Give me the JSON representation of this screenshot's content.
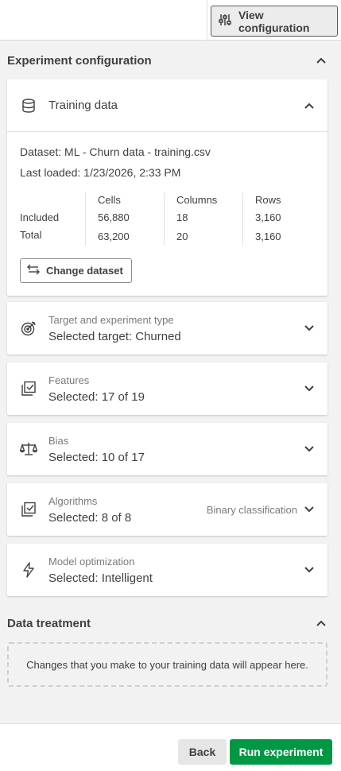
{
  "toolbar": {
    "view_configuration_label": "View configuration"
  },
  "experiment_configuration": {
    "title": "Experiment configuration",
    "training_data": {
      "title": "Training data",
      "dataset": "Dataset: ML - Churn data - training.csv",
      "last_loaded": "Last loaded: 1/23/2026, 2:33 PM",
      "columns": [
        "Cells",
        "Columns",
        "Rows"
      ],
      "rows": [
        {
          "label": "Included",
          "values": [
            "56,880",
            "18",
            "3,160"
          ]
        },
        {
          "label": "Total",
          "values": [
            "63,200",
            "20",
            "3,160"
          ]
        }
      ],
      "change_dataset_label": "Change dataset"
    },
    "cards": [
      {
        "label": "Target and experiment type",
        "value": "Selected target: Churned",
        "icon": "target-icon"
      },
      {
        "label": "Features",
        "value": "Selected: 17 of 19",
        "icon": "checklist-icon"
      },
      {
        "label": "Bias",
        "value": "Selected: 10 of 17",
        "icon": "scale-icon"
      },
      {
        "label": "Algorithms",
        "value": "Selected: 8 of 8",
        "extra": "Binary classification",
        "icon": "checklist-icon"
      },
      {
        "label": "Model optimization",
        "value": "Selected: Intelligent",
        "icon": "lightning-icon"
      }
    ]
  },
  "data_treatment": {
    "title": "Data treatment",
    "placeholder": "Changes that you make to your training data will appear here."
  },
  "footer": {
    "back_label": "Back",
    "run_label": "Run experiment"
  },
  "colors": {
    "primary_green": "#009845",
    "text": "#404040",
    "panel_bg": "#f2f2f2"
  }
}
